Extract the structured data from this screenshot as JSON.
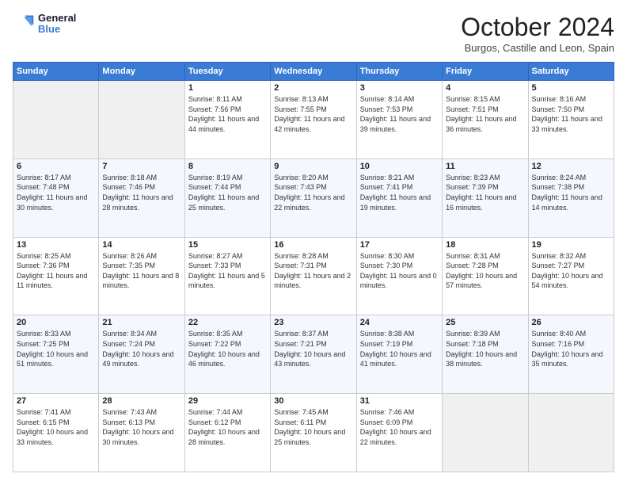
{
  "header": {
    "logo_line1": "General",
    "logo_line2": "Blue",
    "month": "October 2024",
    "location": "Burgos, Castille and Leon, Spain"
  },
  "days_of_week": [
    "Sunday",
    "Monday",
    "Tuesday",
    "Wednesday",
    "Thursday",
    "Friday",
    "Saturday"
  ],
  "weeks": [
    [
      {
        "day": "",
        "sunrise": "",
        "sunset": "",
        "daylight": ""
      },
      {
        "day": "",
        "sunrise": "",
        "sunset": "",
        "daylight": ""
      },
      {
        "day": "1",
        "sunrise": "Sunrise: 8:11 AM",
        "sunset": "Sunset: 7:56 PM",
        "daylight": "Daylight: 11 hours and 44 minutes."
      },
      {
        "day": "2",
        "sunrise": "Sunrise: 8:13 AM",
        "sunset": "Sunset: 7:55 PM",
        "daylight": "Daylight: 11 hours and 42 minutes."
      },
      {
        "day": "3",
        "sunrise": "Sunrise: 8:14 AM",
        "sunset": "Sunset: 7:53 PM",
        "daylight": "Daylight: 11 hours and 39 minutes."
      },
      {
        "day": "4",
        "sunrise": "Sunrise: 8:15 AM",
        "sunset": "Sunset: 7:51 PM",
        "daylight": "Daylight: 11 hours and 36 minutes."
      },
      {
        "day": "5",
        "sunrise": "Sunrise: 8:16 AM",
        "sunset": "Sunset: 7:50 PM",
        "daylight": "Daylight: 11 hours and 33 minutes."
      }
    ],
    [
      {
        "day": "6",
        "sunrise": "Sunrise: 8:17 AM",
        "sunset": "Sunset: 7:48 PM",
        "daylight": "Daylight: 11 hours and 30 minutes."
      },
      {
        "day": "7",
        "sunrise": "Sunrise: 8:18 AM",
        "sunset": "Sunset: 7:46 PM",
        "daylight": "Daylight: 11 hours and 28 minutes."
      },
      {
        "day": "8",
        "sunrise": "Sunrise: 8:19 AM",
        "sunset": "Sunset: 7:44 PM",
        "daylight": "Daylight: 11 hours and 25 minutes."
      },
      {
        "day": "9",
        "sunrise": "Sunrise: 8:20 AM",
        "sunset": "Sunset: 7:43 PM",
        "daylight": "Daylight: 11 hours and 22 minutes."
      },
      {
        "day": "10",
        "sunrise": "Sunrise: 8:21 AM",
        "sunset": "Sunset: 7:41 PM",
        "daylight": "Daylight: 11 hours and 19 minutes."
      },
      {
        "day": "11",
        "sunrise": "Sunrise: 8:23 AM",
        "sunset": "Sunset: 7:39 PM",
        "daylight": "Daylight: 11 hours and 16 minutes."
      },
      {
        "day": "12",
        "sunrise": "Sunrise: 8:24 AM",
        "sunset": "Sunset: 7:38 PM",
        "daylight": "Daylight: 11 hours and 14 minutes."
      }
    ],
    [
      {
        "day": "13",
        "sunrise": "Sunrise: 8:25 AM",
        "sunset": "Sunset: 7:36 PM",
        "daylight": "Daylight: 11 hours and 11 minutes."
      },
      {
        "day": "14",
        "sunrise": "Sunrise: 8:26 AM",
        "sunset": "Sunset: 7:35 PM",
        "daylight": "Daylight: 11 hours and 8 minutes."
      },
      {
        "day": "15",
        "sunrise": "Sunrise: 8:27 AM",
        "sunset": "Sunset: 7:33 PM",
        "daylight": "Daylight: 11 hours and 5 minutes."
      },
      {
        "day": "16",
        "sunrise": "Sunrise: 8:28 AM",
        "sunset": "Sunset: 7:31 PM",
        "daylight": "Daylight: 11 hours and 2 minutes."
      },
      {
        "day": "17",
        "sunrise": "Sunrise: 8:30 AM",
        "sunset": "Sunset: 7:30 PM",
        "daylight": "Daylight: 11 hours and 0 minutes."
      },
      {
        "day": "18",
        "sunrise": "Sunrise: 8:31 AM",
        "sunset": "Sunset: 7:28 PM",
        "daylight": "Daylight: 10 hours and 57 minutes."
      },
      {
        "day": "19",
        "sunrise": "Sunrise: 8:32 AM",
        "sunset": "Sunset: 7:27 PM",
        "daylight": "Daylight: 10 hours and 54 minutes."
      }
    ],
    [
      {
        "day": "20",
        "sunrise": "Sunrise: 8:33 AM",
        "sunset": "Sunset: 7:25 PM",
        "daylight": "Daylight: 10 hours and 51 minutes."
      },
      {
        "day": "21",
        "sunrise": "Sunrise: 8:34 AM",
        "sunset": "Sunset: 7:24 PM",
        "daylight": "Daylight: 10 hours and 49 minutes."
      },
      {
        "day": "22",
        "sunrise": "Sunrise: 8:35 AM",
        "sunset": "Sunset: 7:22 PM",
        "daylight": "Daylight: 10 hours and 46 minutes."
      },
      {
        "day": "23",
        "sunrise": "Sunrise: 8:37 AM",
        "sunset": "Sunset: 7:21 PM",
        "daylight": "Daylight: 10 hours and 43 minutes."
      },
      {
        "day": "24",
        "sunrise": "Sunrise: 8:38 AM",
        "sunset": "Sunset: 7:19 PM",
        "daylight": "Daylight: 10 hours and 41 minutes."
      },
      {
        "day": "25",
        "sunrise": "Sunrise: 8:39 AM",
        "sunset": "Sunset: 7:18 PM",
        "daylight": "Daylight: 10 hours and 38 minutes."
      },
      {
        "day": "26",
        "sunrise": "Sunrise: 8:40 AM",
        "sunset": "Sunset: 7:16 PM",
        "daylight": "Daylight: 10 hours and 35 minutes."
      }
    ],
    [
      {
        "day": "27",
        "sunrise": "Sunrise: 7:41 AM",
        "sunset": "Sunset: 6:15 PM",
        "daylight": "Daylight: 10 hours and 33 minutes."
      },
      {
        "day": "28",
        "sunrise": "Sunrise: 7:43 AM",
        "sunset": "Sunset: 6:13 PM",
        "daylight": "Daylight: 10 hours and 30 minutes."
      },
      {
        "day": "29",
        "sunrise": "Sunrise: 7:44 AM",
        "sunset": "Sunset: 6:12 PM",
        "daylight": "Daylight: 10 hours and 28 minutes."
      },
      {
        "day": "30",
        "sunrise": "Sunrise: 7:45 AM",
        "sunset": "Sunset: 6:11 PM",
        "daylight": "Daylight: 10 hours and 25 minutes."
      },
      {
        "day": "31",
        "sunrise": "Sunrise: 7:46 AM",
        "sunset": "Sunset: 6:09 PM",
        "daylight": "Daylight: 10 hours and 22 minutes."
      },
      {
        "day": "",
        "sunrise": "",
        "sunset": "",
        "daylight": ""
      },
      {
        "day": "",
        "sunrise": "",
        "sunset": "",
        "daylight": ""
      }
    ]
  ]
}
